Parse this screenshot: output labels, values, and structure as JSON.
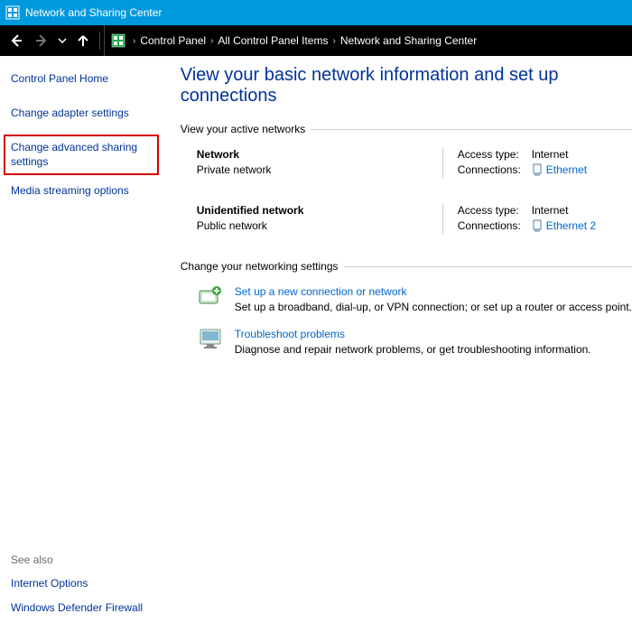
{
  "window": {
    "title": "Network and Sharing Center"
  },
  "breadcrumb": {
    "items": [
      "Control Panel",
      "All Control Panel Items",
      "Network and Sharing Center"
    ]
  },
  "sidebar": {
    "home": "Control Panel Home",
    "links": [
      "Change adapter settings",
      "Change advanced sharing settings",
      "Media streaming options"
    ],
    "see_also_label": "See also",
    "see_also": [
      "Internet Options",
      "Windows Defender Firewall"
    ]
  },
  "main": {
    "heading": "View your basic network information and set up connections",
    "active_label": "View your active networks",
    "networks": [
      {
        "name": "Network",
        "type": "Private network",
        "access_label": "Access type:",
        "access_value": "Internet",
        "conn_label": "Connections:",
        "conn_value": "Ethernet"
      },
      {
        "name": "Unidentified network",
        "type": "Public network",
        "access_label": "Access type:",
        "access_value": "Internet",
        "conn_label": "Connections:",
        "conn_value": "Ethernet 2"
      }
    ],
    "change_label": "Change your networking settings",
    "settings": [
      {
        "title": "Set up a new connection or network",
        "desc": "Set up a broadband, dial-up, or VPN connection; or set up a router or access point."
      },
      {
        "title": "Troubleshoot problems",
        "desc": "Diagnose and repair network problems, or get troubleshooting information."
      }
    ]
  }
}
